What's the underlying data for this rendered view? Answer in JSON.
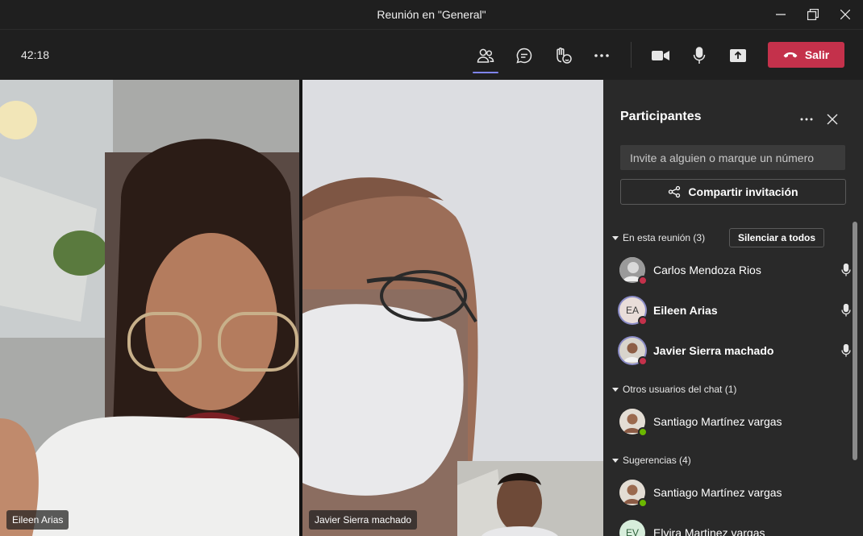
{
  "window": {
    "title": "Reunión en \"General\""
  },
  "toolbar": {
    "timer": "42:18",
    "leave_label": "Salir"
  },
  "videos": [
    {
      "name": "Eileen Arias"
    },
    {
      "name": "Javier Sierra machado"
    }
  ],
  "panel": {
    "title": "Participantes",
    "invite_placeholder": "Invite a alguien o marque un número",
    "share_label": "Compartir invitación",
    "in_meeting_label": "En esta reunión (3)",
    "mute_all_label": "Silenciar a todos",
    "in_meeting": [
      {
        "name": "Carlos Mendoza Rios",
        "initials": "",
        "presence": "busy",
        "bold": false
      },
      {
        "name": "Eileen Arias",
        "initials": "EA",
        "presence": "busy",
        "bold": true
      },
      {
        "name": "Javier Sierra machado",
        "initials": "",
        "presence": "busy",
        "bold": true
      }
    ],
    "chat_users_label": "Otros usuarios del chat (1)",
    "chat_users": [
      {
        "name": "Santiago Martínez vargas",
        "presence": "available"
      }
    ],
    "suggestions_label": "Sugerencias (4)",
    "suggestions": [
      {
        "name": "Santiago Martínez vargas",
        "initials": "",
        "presence": "available"
      },
      {
        "name": "Elvira Martinez vargas",
        "initials": "EV",
        "presence": ""
      }
    ]
  },
  "colors": {
    "accent": "#7f85f5",
    "leave": "#c4314b",
    "busy": "#c4314b",
    "available": "#6bb700",
    "panel_bg": "#292929"
  }
}
